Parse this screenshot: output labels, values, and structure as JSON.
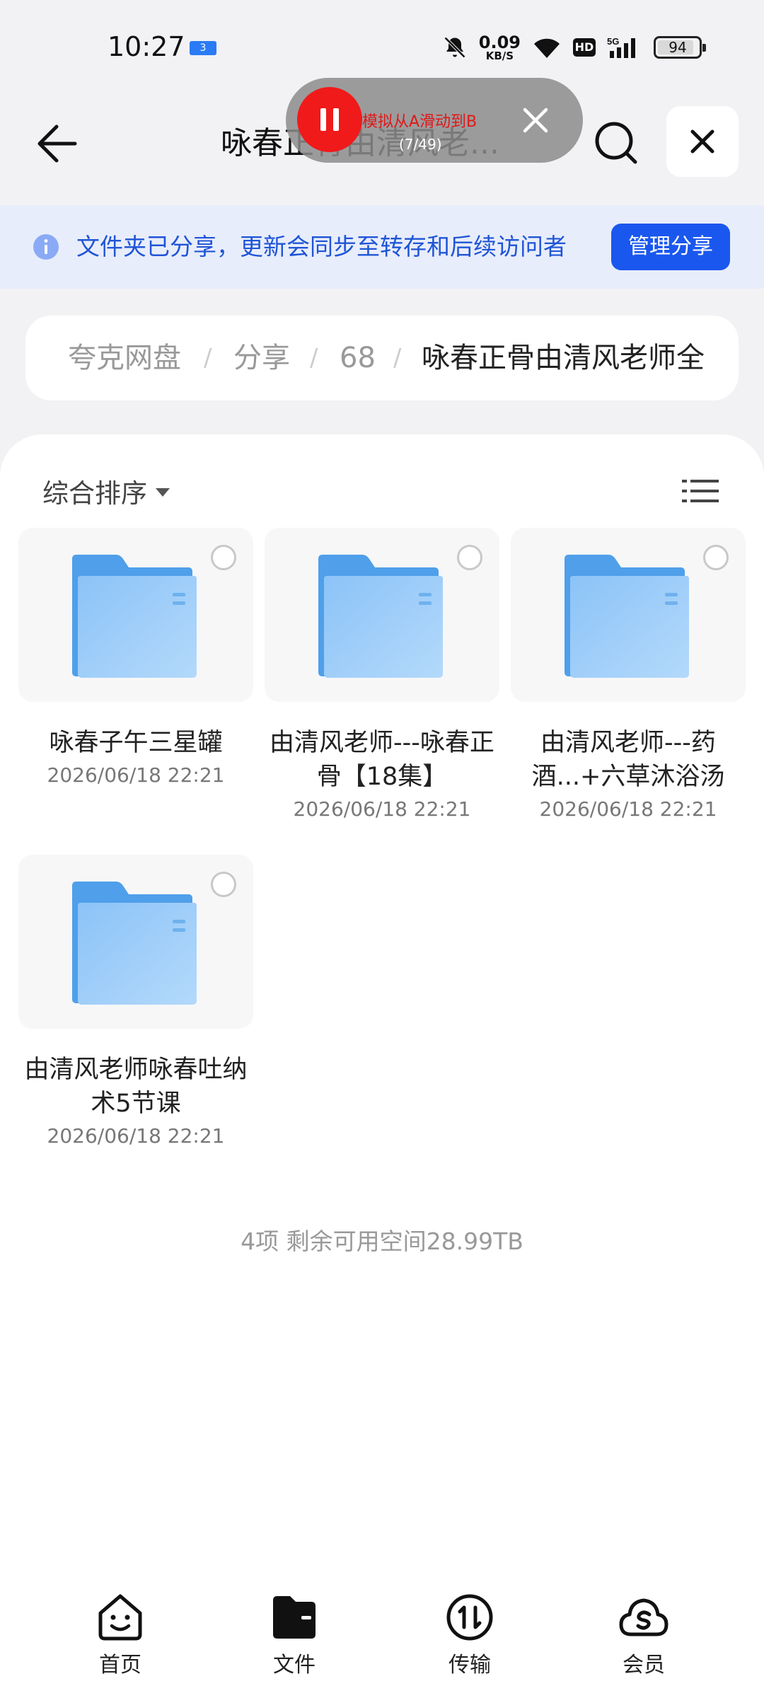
{
  "status_bar": {
    "time": "10:27",
    "app_indicator": "3",
    "net_speed_value": "0.09",
    "net_speed_unit": "KB/S",
    "hd_label": "HD",
    "signal_label": "5G",
    "battery": "94"
  },
  "header": {
    "title": "咏春正骨由清风老..."
  },
  "recorder": {
    "text": "模拟从A滑动到B",
    "count": "(7/49)"
  },
  "share_banner": {
    "text": "文件夹已分享，更新会同步至转存和后续访问者",
    "manage_label": "管理分享"
  },
  "breadcrumb": {
    "items": [
      "夸克网盘",
      "分享",
      "68",
      "咏春正骨由清风老师全"
    ],
    "separator": "/"
  },
  "toolbar": {
    "sort_label": "综合排序"
  },
  "files": [
    {
      "name": "咏春子午三星罐",
      "date": "2026/06/18 22:21"
    },
    {
      "name": "由清风老师---咏春正骨【18集】",
      "date": "2026/06/18 22:21"
    },
    {
      "name": "由清风老师---药酒...+六草沐浴汤",
      "date": "2026/06/18 22:21"
    },
    {
      "name": "由清风老师咏春吐纳术5节课",
      "date": "2026/06/18 22:21"
    }
  ],
  "summary": "4项 剩余可用空间28.99TB",
  "bottom_nav": [
    {
      "label": "首页",
      "icon": "home-smile-icon",
      "active": false
    },
    {
      "label": "文件",
      "icon": "folder-icon",
      "active": true
    },
    {
      "label": "传输",
      "icon": "transfer-icon",
      "active": false
    },
    {
      "label": "会员",
      "icon": "cloud-member-icon",
      "active": false
    }
  ],
  "colors": {
    "accent": "#1a57ee",
    "banner_bg": "#e8edfb",
    "banner_text": "#1f55d6",
    "folder": "#64b0f2",
    "recorder_red": "#f01a1a"
  }
}
